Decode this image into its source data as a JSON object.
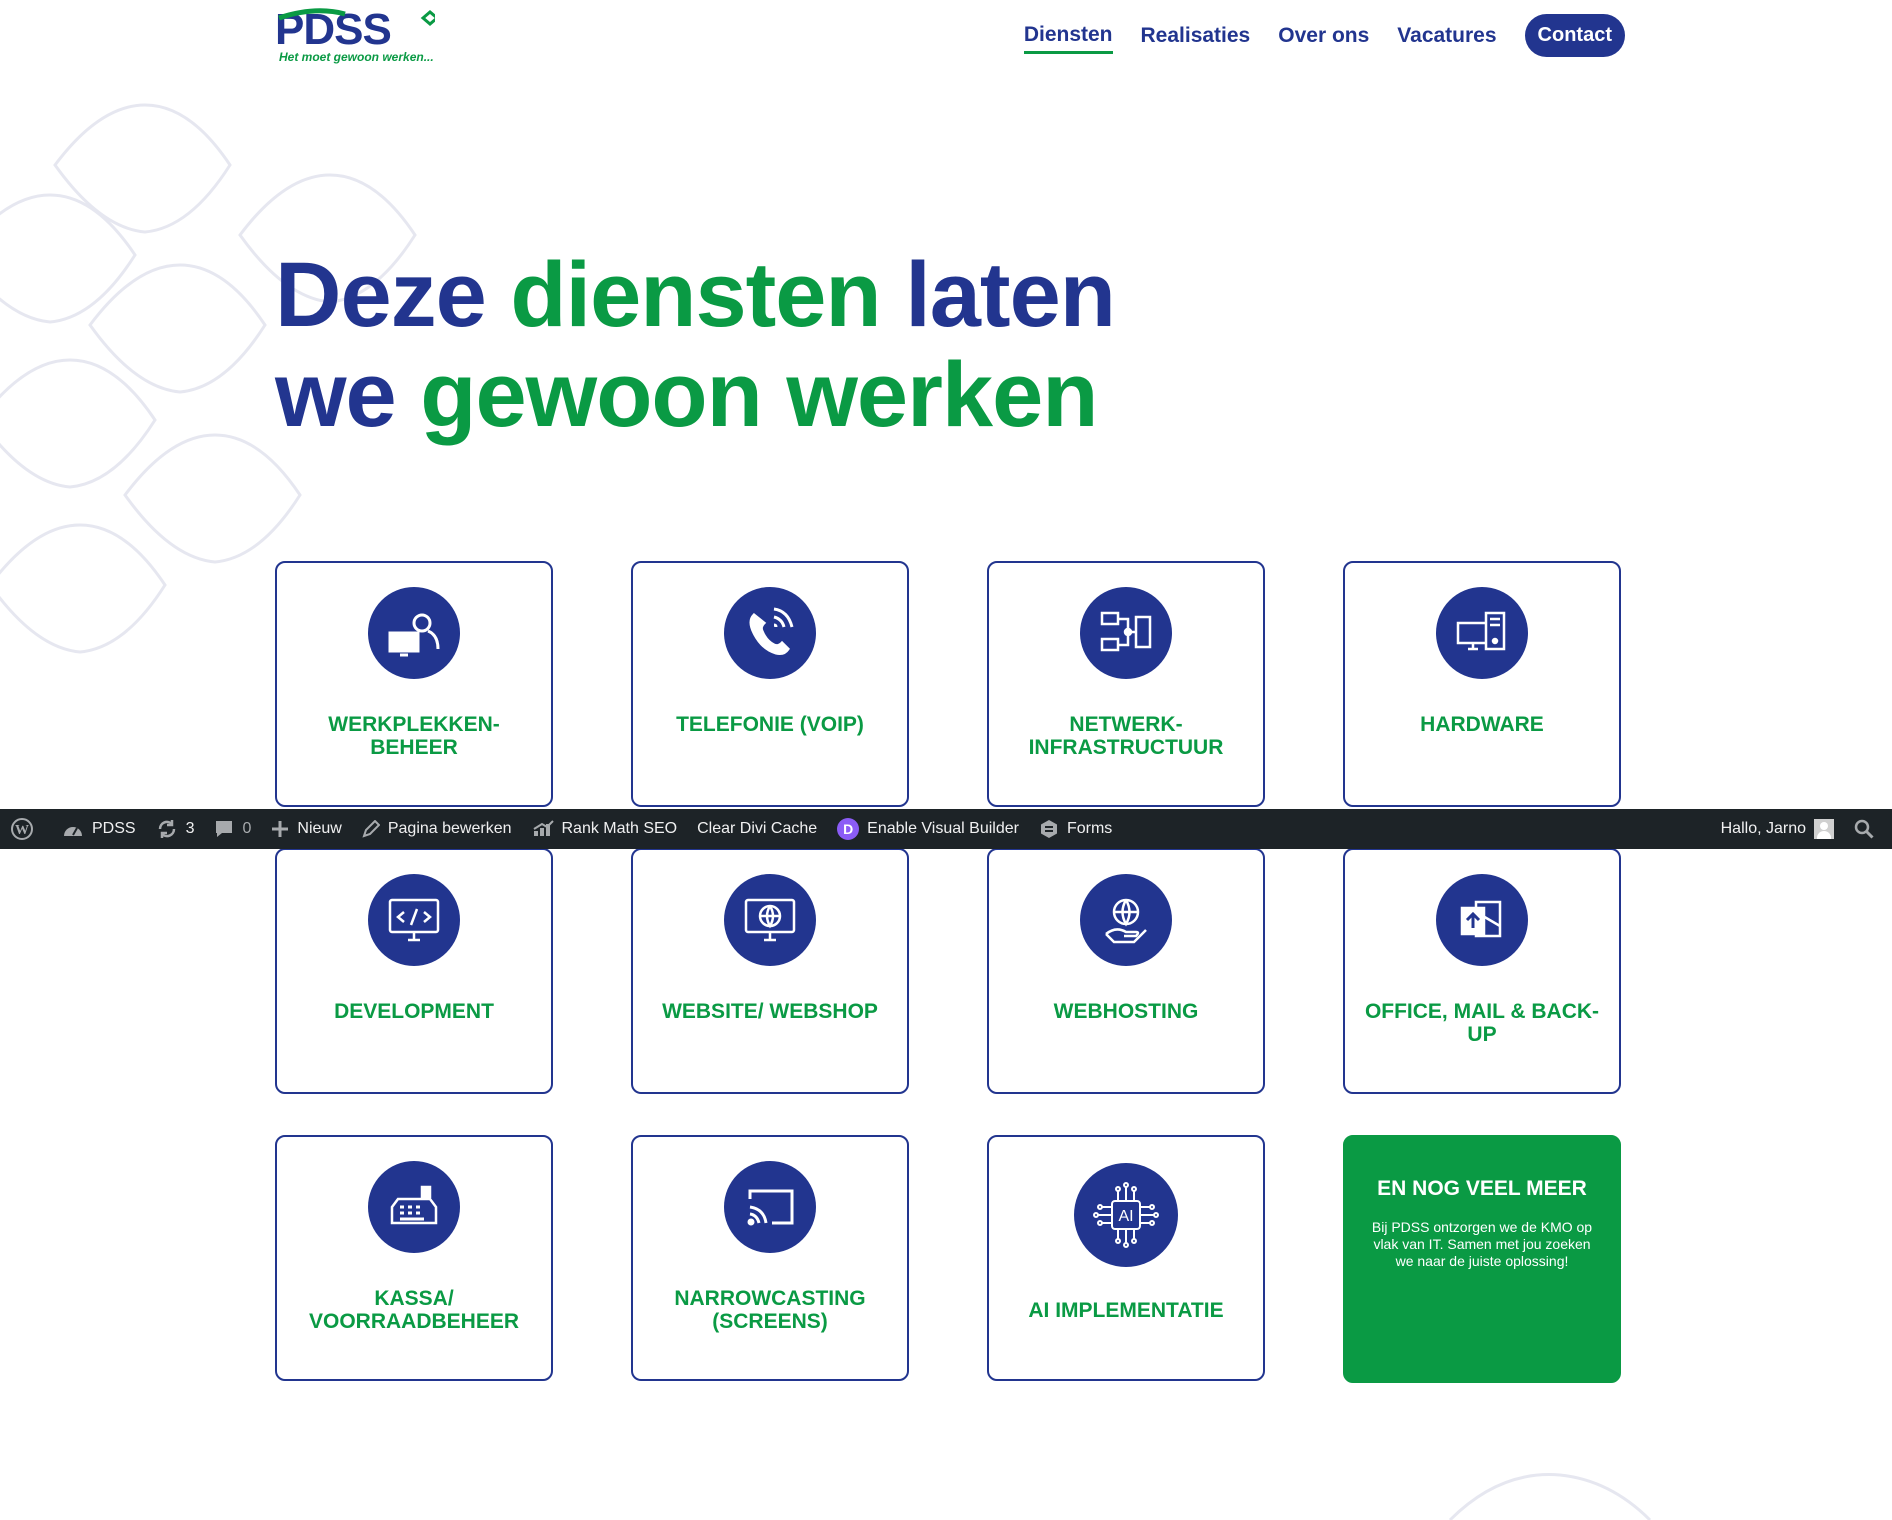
{
  "brand": {
    "logo_text": "PDSS",
    "tagline": "Het moet gewoon werken..."
  },
  "colors": {
    "blue": "#22358f",
    "green": "#0a9a44",
    "admin_bar": "#1d2327"
  },
  "nav": {
    "items": [
      {
        "label": "Diensten",
        "active": true
      },
      {
        "label": "Realisaties"
      },
      {
        "label": "Over ons"
      },
      {
        "label": "Vacatures"
      }
    ],
    "contact": "Contact"
  },
  "hero": {
    "line1_part1": "Deze ",
    "line1_part2": "diensten",
    "line1_part3": " laten",
    "line2_part1": "we ",
    "line2_part2": "gewoon werken"
  },
  "services": [
    {
      "label": "WERKPLEKKEN-BEHEER",
      "icon": "user-workstation-icon"
    },
    {
      "label": "TELEFONIE (VOIP)",
      "icon": "phone-icon"
    },
    {
      "label": "NETWERK-INFRASTRUCTUUR",
      "icon": "network-icon"
    },
    {
      "label": "HARDWARE",
      "icon": "computer-tower-icon"
    },
    {
      "label": "DEVELOPMENT",
      "icon": "code-monitor-icon"
    },
    {
      "label": "WEBSITE/ WEBSHOP",
      "icon": "globe-monitor-icon"
    },
    {
      "label": "WEBHOSTING",
      "icon": "globe-hand-icon"
    },
    {
      "label": "OFFICE, MAIL & BACK-UP",
      "icon": "mail-upload-icon"
    },
    {
      "label": "KASSA/ VOORRAADBEHEER",
      "icon": "cash-register-icon"
    },
    {
      "label": "NARROWCASTING (SCREENS)",
      "icon": "cast-screen-icon"
    },
    {
      "label": "AI IMPLEMENTATIE",
      "icon": "ai-chip-icon"
    }
  ],
  "more": {
    "title": "EN NOG VEEL MEER",
    "text": "Bij PDSS ontzorgen we de KMO op vlak van IT. Samen met jou zoeken we naar de juiste oplossing!"
  },
  "adminbar": {
    "site": "PDSS",
    "updates": "3",
    "comments": "0",
    "new": "Nieuw",
    "edit": "Pagina bewerken",
    "rankmath": "Rank Math SEO",
    "cache": "Clear Divi Cache",
    "divi_letter": "D",
    "builder": "Enable Visual Builder",
    "forms": "Forms",
    "greeting": "Hallo, Jarno"
  }
}
